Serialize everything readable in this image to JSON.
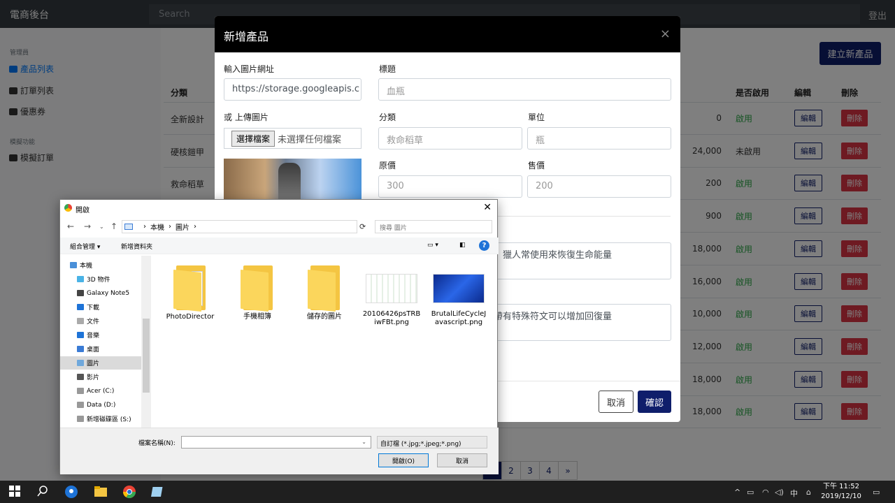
{
  "app": {
    "brand": "電商後台",
    "search_placeholder": "Search",
    "logout": "登出"
  },
  "sidebar": {
    "section_admin": "管理員",
    "items": [
      {
        "label": "產品列表",
        "icon": "boxes-icon"
      },
      {
        "label": "訂單列表",
        "icon": "list-icon"
      },
      {
        "label": "優惠券",
        "icon": "ticket-icon"
      }
    ],
    "section_sim": "模擬功能",
    "sim_items": [
      {
        "label": "模擬訂單",
        "icon": "cart-icon"
      }
    ]
  },
  "main": {
    "create_button": "建立新產品",
    "columns": [
      "分類",
      "是否啟用",
      "編輯",
      "刪除"
    ],
    "rows": [
      {
        "category": "全新設計",
        "price": "0",
        "status": "啟用"
      },
      {
        "category": "硬核鎧甲",
        "price": "24,000",
        "status": "未啟用"
      },
      {
        "category": "救命稻草",
        "price": "200",
        "status": "啟用"
      },
      {
        "category": "",
        "price": "900",
        "status": "啟用"
      },
      {
        "category": "",
        "price": "18,000",
        "status": "啟用"
      },
      {
        "category": "",
        "price": "16,000",
        "status": "啟用"
      },
      {
        "category": "",
        "price": "10,000",
        "status": "啟用"
      },
      {
        "category": "",
        "price": "12,000",
        "status": "啟用"
      },
      {
        "category": "",
        "price": "18,000",
        "status": "啟用"
      },
      {
        "category": "",
        "price": "18,000",
        "status": "啟用"
      }
    ],
    "edit_label": "編輯",
    "delete_label": "刪除",
    "pagination": [
      "2",
      "3",
      "4",
      "»"
    ]
  },
  "modal": {
    "title": "新增產品",
    "close": "×",
    "image_url_label": "輸入圖片網址",
    "image_url_value": "https://storage.googleapis.c",
    "upload_label": "或 上傳圖片",
    "file_button": "選擇檔案",
    "file_status": "未選擇任何檔案",
    "title_label": "標題",
    "title_placeholder": "血瓶",
    "category_label": "分類",
    "category_placeholder": "救命稻草",
    "unit_label": "單位",
    "unit_placeholder": "瓶",
    "orig_price_label": "原價",
    "orig_price_placeholder": "300",
    "price_label": "售價",
    "price_placeholder": "200",
    "desc_text": "，獵人常使用來恢復生命能量",
    "content_text": "帶有特殊符文可以增加回復量",
    "cancel": "取消",
    "confirm": "確認"
  },
  "dialog": {
    "title": "開啟",
    "breadcrumb": [
      "本機",
      "圖片"
    ],
    "search_placeholder": "搜尋 圖片",
    "organize": "組合管理 ▾",
    "new_folder": "新增資料夾",
    "tree": [
      {
        "label": "本機",
        "icon": "computer-icon"
      },
      {
        "label": "3D 物件",
        "icon": "cube-icon"
      },
      {
        "label": "Galaxy Note5",
        "icon": "phone-icon"
      },
      {
        "label": "下載",
        "icon": "download-icon"
      },
      {
        "label": "文件",
        "icon": "document-icon"
      },
      {
        "label": "音樂",
        "icon": "music-icon"
      },
      {
        "label": "桌面",
        "icon": "desktop-icon"
      },
      {
        "label": "圖片",
        "icon": "pictures-icon"
      },
      {
        "label": "影片",
        "icon": "video-icon"
      },
      {
        "label": "Acer (C:)",
        "icon": "drive-icon"
      },
      {
        "label": "Data (D:)",
        "icon": "drive-icon"
      },
      {
        "label": "新增磁碟區 (S:)",
        "icon": "drive-icon"
      }
    ],
    "files": [
      {
        "name": "PhotoDirector",
        "kind": "folder"
      },
      {
        "name": "手機相簿",
        "kind": "folder"
      },
      {
        "name": "儲存的圖片",
        "kind": "folder"
      },
      {
        "name": "20106426psTRBiwFBt.png",
        "kind": "image-diagram"
      },
      {
        "name": "BrutalLifeCycleJavascript.png",
        "kind": "image-blue"
      }
    ],
    "filename_label": "檔案名稱(N):",
    "filetype": "自訂檔 (*.jpg;*.jpeg;*.png)",
    "open_button": "開啟(O)",
    "cancel_button": "取消"
  },
  "taskbar": {
    "time": "下午 11:52",
    "date": "2019/12/10",
    "ime": "中"
  }
}
